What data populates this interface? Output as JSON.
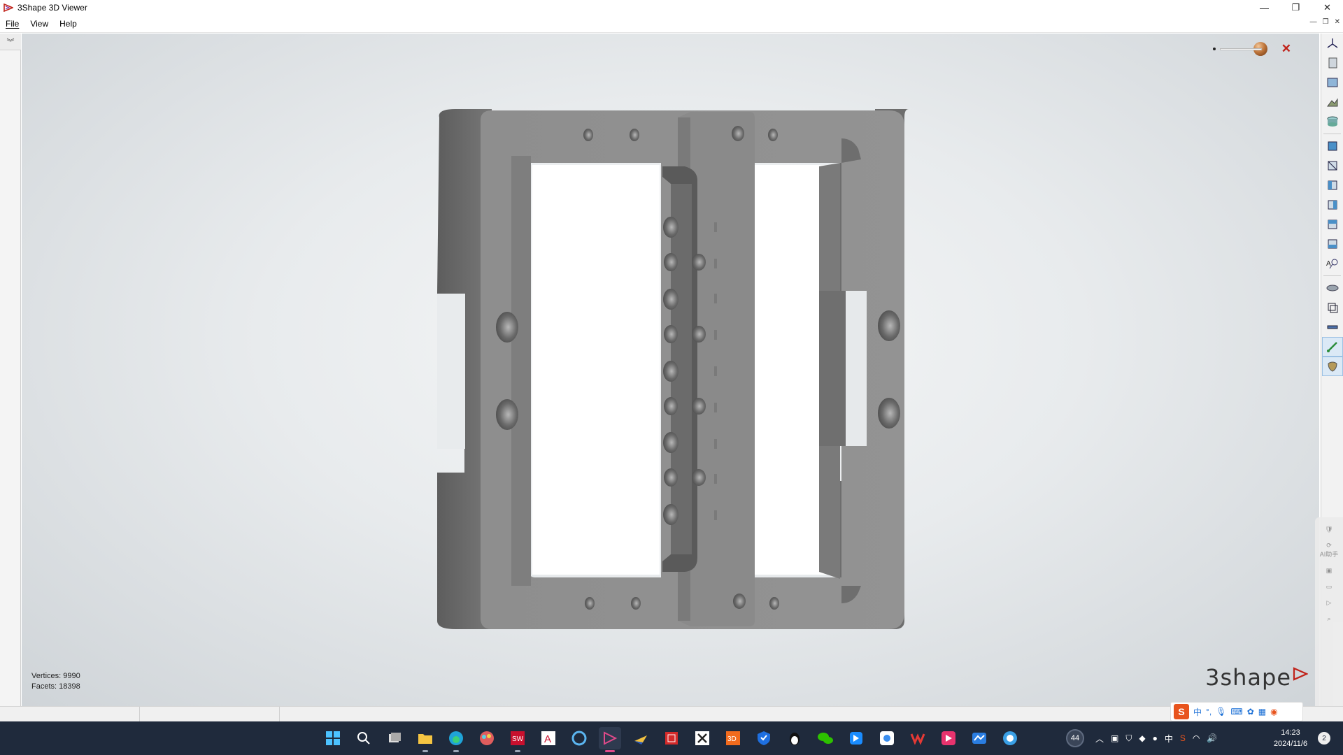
{
  "window": {
    "title": "3Shape 3D Viewer",
    "minimize": "—",
    "restore": "❐",
    "close": "✕"
  },
  "menu": {
    "items": [
      {
        "label": "File"
      },
      {
        "label": "View"
      },
      {
        "label": "Help"
      }
    ]
  },
  "viewport": {
    "stats": {
      "vertices": "Vertices: 9990",
      "facets": "Facets: 18398"
    },
    "brand": "3shape"
  },
  "toolbar_icons": [
    "axes-icon",
    "page-icon",
    "view-panel-icon",
    "landscape-icon",
    "cylinder-icon",
    "view-front-icon",
    "view-back-icon",
    "view-left-icon",
    "view-right-icon",
    "view-top-icon",
    "view-bottom-icon",
    "text-search-icon",
    "shading-icon",
    "wireframe-icon",
    "measure-icon",
    "cut-icon",
    "texture-icon"
  ],
  "taskbar": {
    "badge": "44",
    "ime_lang": "中",
    "time": "14:23",
    "date": "2024/11/6",
    "notifications": "2"
  },
  "ime": {
    "items": [
      "中",
      "°,"
    ]
  },
  "side_assist": {
    "ai_label": "AI助手"
  },
  "colors": {
    "model": "#8f8f8f",
    "accent_red": "#c0221a",
    "taskbar": "#1f2a3c"
  }
}
